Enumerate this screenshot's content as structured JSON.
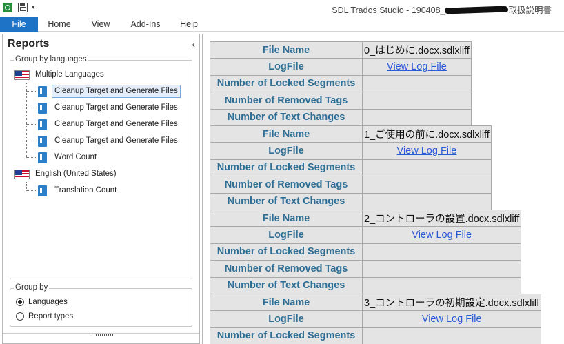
{
  "window": {
    "title_prefix": "SDL Trados Studio - 190408_",
    "title_suffix": "取扱説明書",
    "quick_access_dropdown": "▾"
  },
  "menu": {
    "file": "File",
    "home": "Home",
    "view": "View",
    "addins": "Add-Ins",
    "help": "Help"
  },
  "reports_panel": {
    "title": "Reports",
    "collapse_glyph": "‹",
    "group_by_languages_legend": "Group by languages",
    "tree": {
      "multiple_languages": "Multiple Languages",
      "multi_items": [
        "Cleanup Target and Generate Files",
        "Cleanup Target and Generate Files",
        "Cleanup Target and Generate Files",
        "Cleanup Target and Generate Files",
        "Word Count"
      ],
      "english_us": "English (United States)",
      "english_items": [
        "Translation Count"
      ]
    },
    "group_by_legend": "Group by",
    "radio_languages": "Languages",
    "radio_report_types": "Report types",
    "selected_radio": "Languages"
  },
  "report": {
    "labels": {
      "file_name": "File Name",
      "log_file": "LogFile",
      "locked": "Number of Locked Segments",
      "removed_tags": "Number of Removed Tags",
      "text_changes": "Number of Text Changes"
    },
    "log_link_text": "View Log File",
    "files": [
      {
        "file_name": "0_はじめに.docx.sdlxliff"
      },
      {
        "file_name": "1_ご使用の前に.docx.sdlxliff"
      },
      {
        "file_name": "2_コントローラの設置.docx.sdlxliff"
      },
      {
        "file_name": "3_コントローラの初期設定.docx.sdlxliff"
      }
    ]
  },
  "colors": {
    "accent": "#1e73c6",
    "label_text": "#2f6f95",
    "link": "#2a5bd7",
    "cell_bg": "#e4e4e4"
  }
}
